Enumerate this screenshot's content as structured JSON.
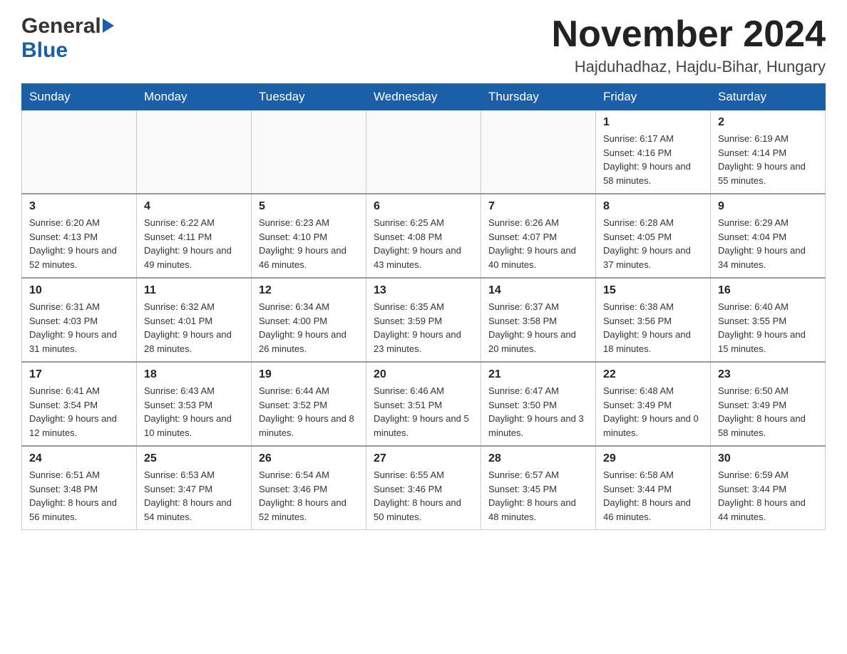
{
  "header": {
    "month_title": "November 2024",
    "location": "Hajduhadhaz, Hajdu-Bihar, Hungary",
    "logo_general": "General",
    "logo_blue": "Blue"
  },
  "weekdays": [
    "Sunday",
    "Monday",
    "Tuesday",
    "Wednesday",
    "Thursday",
    "Friday",
    "Saturday"
  ],
  "weeks": [
    [
      {
        "day": "",
        "info": ""
      },
      {
        "day": "",
        "info": ""
      },
      {
        "day": "",
        "info": ""
      },
      {
        "day": "",
        "info": ""
      },
      {
        "day": "",
        "info": ""
      },
      {
        "day": "1",
        "info": "Sunrise: 6:17 AM\nSunset: 4:16 PM\nDaylight: 9 hours and 58 minutes."
      },
      {
        "day": "2",
        "info": "Sunrise: 6:19 AM\nSunset: 4:14 PM\nDaylight: 9 hours and 55 minutes."
      }
    ],
    [
      {
        "day": "3",
        "info": "Sunrise: 6:20 AM\nSunset: 4:13 PM\nDaylight: 9 hours and 52 minutes."
      },
      {
        "day": "4",
        "info": "Sunrise: 6:22 AM\nSunset: 4:11 PM\nDaylight: 9 hours and 49 minutes."
      },
      {
        "day": "5",
        "info": "Sunrise: 6:23 AM\nSunset: 4:10 PM\nDaylight: 9 hours and 46 minutes."
      },
      {
        "day": "6",
        "info": "Sunrise: 6:25 AM\nSunset: 4:08 PM\nDaylight: 9 hours and 43 minutes."
      },
      {
        "day": "7",
        "info": "Sunrise: 6:26 AM\nSunset: 4:07 PM\nDaylight: 9 hours and 40 minutes."
      },
      {
        "day": "8",
        "info": "Sunrise: 6:28 AM\nSunset: 4:05 PM\nDaylight: 9 hours and 37 minutes."
      },
      {
        "day": "9",
        "info": "Sunrise: 6:29 AM\nSunset: 4:04 PM\nDaylight: 9 hours and 34 minutes."
      }
    ],
    [
      {
        "day": "10",
        "info": "Sunrise: 6:31 AM\nSunset: 4:03 PM\nDaylight: 9 hours and 31 minutes."
      },
      {
        "day": "11",
        "info": "Sunrise: 6:32 AM\nSunset: 4:01 PM\nDaylight: 9 hours and 28 minutes."
      },
      {
        "day": "12",
        "info": "Sunrise: 6:34 AM\nSunset: 4:00 PM\nDaylight: 9 hours and 26 minutes."
      },
      {
        "day": "13",
        "info": "Sunrise: 6:35 AM\nSunset: 3:59 PM\nDaylight: 9 hours and 23 minutes."
      },
      {
        "day": "14",
        "info": "Sunrise: 6:37 AM\nSunset: 3:58 PM\nDaylight: 9 hours and 20 minutes."
      },
      {
        "day": "15",
        "info": "Sunrise: 6:38 AM\nSunset: 3:56 PM\nDaylight: 9 hours and 18 minutes."
      },
      {
        "day": "16",
        "info": "Sunrise: 6:40 AM\nSunset: 3:55 PM\nDaylight: 9 hours and 15 minutes."
      }
    ],
    [
      {
        "day": "17",
        "info": "Sunrise: 6:41 AM\nSunset: 3:54 PM\nDaylight: 9 hours and 12 minutes."
      },
      {
        "day": "18",
        "info": "Sunrise: 6:43 AM\nSunset: 3:53 PM\nDaylight: 9 hours and 10 minutes."
      },
      {
        "day": "19",
        "info": "Sunrise: 6:44 AM\nSunset: 3:52 PM\nDaylight: 9 hours and 8 minutes."
      },
      {
        "day": "20",
        "info": "Sunrise: 6:46 AM\nSunset: 3:51 PM\nDaylight: 9 hours and 5 minutes."
      },
      {
        "day": "21",
        "info": "Sunrise: 6:47 AM\nSunset: 3:50 PM\nDaylight: 9 hours and 3 minutes."
      },
      {
        "day": "22",
        "info": "Sunrise: 6:48 AM\nSunset: 3:49 PM\nDaylight: 9 hours and 0 minutes."
      },
      {
        "day": "23",
        "info": "Sunrise: 6:50 AM\nSunset: 3:49 PM\nDaylight: 8 hours and 58 minutes."
      }
    ],
    [
      {
        "day": "24",
        "info": "Sunrise: 6:51 AM\nSunset: 3:48 PM\nDaylight: 8 hours and 56 minutes."
      },
      {
        "day": "25",
        "info": "Sunrise: 6:53 AM\nSunset: 3:47 PM\nDaylight: 8 hours and 54 minutes."
      },
      {
        "day": "26",
        "info": "Sunrise: 6:54 AM\nSunset: 3:46 PM\nDaylight: 8 hours and 52 minutes."
      },
      {
        "day": "27",
        "info": "Sunrise: 6:55 AM\nSunset: 3:46 PM\nDaylight: 8 hours and 50 minutes."
      },
      {
        "day": "28",
        "info": "Sunrise: 6:57 AM\nSunset: 3:45 PM\nDaylight: 8 hours and 48 minutes."
      },
      {
        "day": "29",
        "info": "Sunrise: 6:58 AM\nSunset: 3:44 PM\nDaylight: 8 hours and 46 minutes."
      },
      {
        "day": "30",
        "info": "Sunrise: 6:59 AM\nSunset: 3:44 PM\nDaylight: 8 hours and 44 minutes."
      }
    ]
  ]
}
